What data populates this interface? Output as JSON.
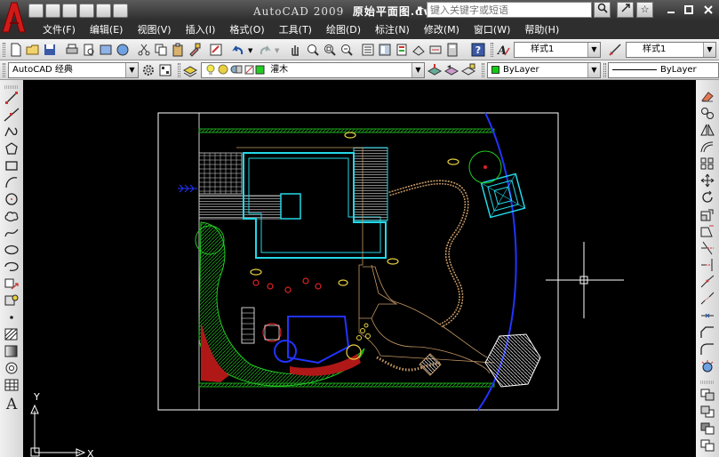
{
  "window": {
    "app_title": "AutoCAD 2009",
    "file_name": "原始平面图.dwg",
    "search_placeholder": "键入关键字或短语"
  },
  "menu": {
    "items": [
      "文件(F)",
      "编辑(E)",
      "视图(V)",
      "插入(I)",
      "格式(O)",
      "工具(T)",
      "绘图(D)",
      "标注(N)",
      "修改(M)",
      "窗口(W)",
      "帮助(H)"
    ]
  },
  "toolbar": {
    "text_style": "样式1",
    "dim_style": "样式1",
    "workspace": "AutoCAD 经典",
    "layer": "灌木",
    "color": "ByLayer",
    "linetype": "ByLayer"
  },
  "ucs": {
    "x_label": "X",
    "y_label": "Y"
  },
  "colors": {
    "cyan": "#22d8e8",
    "green": "#22cc22",
    "blue": "#2233ff",
    "tan": "#c89a66",
    "red": "#dd2222",
    "white": "#ffffff",
    "yellow": "#e8d040"
  },
  "icons": {
    "left_toolbar": [
      "line-icon",
      "construction-line-icon",
      "polyline-icon",
      "polygon-icon",
      "rectangle-icon",
      "arc-icon",
      "circle-icon",
      "revision-cloud-icon",
      "spline-icon",
      "ellipse-icon",
      "ellipse-arc-icon",
      "insert-block-icon",
      "make-block-icon",
      "point-icon",
      "hatch-icon",
      "gradient-icon",
      "region-icon",
      "table-icon",
      "multiline-text-icon"
    ],
    "right_toolbar": [
      "erase-icon",
      "copy-icon",
      "mirror-icon",
      "offset-icon",
      "array-icon",
      "move-icon",
      "rotate-icon",
      "scale-icon",
      "stretch-icon",
      "trim-icon",
      "extend-icon",
      "break-at-point-icon",
      "break-icon",
      "join-icon",
      "chamfer-icon",
      "fillet-icon",
      "explode-icon"
    ]
  }
}
